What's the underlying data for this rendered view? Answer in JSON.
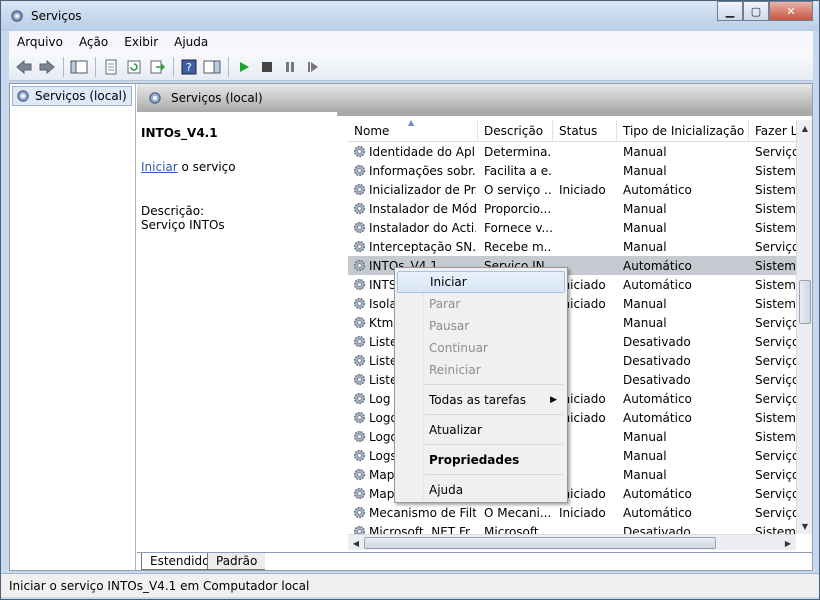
{
  "window": {
    "title": "Serviços",
    "minimize": "▁",
    "maximize": "▢",
    "close": "✕"
  },
  "menubar": [
    {
      "label": "Arquivo"
    },
    {
      "label": "Ação"
    },
    {
      "label": "Exibir"
    },
    {
      "label": "Ajuda"
    }
  ],
  "tree": {
    "item_label": "Serviços (local)"
  },
  "header": {
    "title": "Serviços (local)"
  },
  "details": {
    "service_name": "INTOs_V4.1",
    "action_link": "Iniciar",
    "action_suffix": " o serviço",
    "description_label": "Descrição:",
    "description_text": "Serviço INTOs"
  },
  "columns": {
    "name": "Nome",
    "description": "Descrição",
    "status": "Status",
    "startup": "Tipo de Inicialização",
    "logon": "Fazer Lo"
  },
  "rows": [
    {
      "name": "Identidade do Apli...",
      "description": "Determina...",
      "status": "",
      "startup": "Manual",
      "logon": "Serviço"
    },
    {
      "name": "Informações sobr...",
      "description": "Facilita a e...",
      "status": "",
      "startup": "Manual",
      "logon": "Sistema"
    },
    {
      "name": "Inicializador de Pr...",
      "description": "O serviço ...",
      "status": "Iniciado",
      "startup": "Automático",
      "logon": "Sistema"
    },
    {
      "name": "Instalador de Mód...",
      "description": "Proporcio...",
      "status": "",
      "startup": "Manual",
      "logon": "Sistema"
    },
    {
      "name": "Instalador do Acti...",
      "description": "Fornece v...",
      "status": "",
      "startup": "Manual",
      "logon": "Sistema"
    },
    {
      "name": "Interceptação SN...",
      "description": "Recebe m...",
      "status": "",
      "startup": "Manual",
      "logon": "Serviço"
    },
    {
      "name": "INTOs_V4.1",
      "description": "Serviço IN...",
      "status": "",
      "startup": "Automático",
      "logon": "Sistema"
    },
    {
      "name": "INTS",
      "description": "",
      "status": "Iniciado",
      "startup": "Automático",
      "logon": "Sistema"
    },
    {
      "name": "Isola",
      "description": "",
      "status": "Iniciado",
      "startup": "Manual",
      "logon": "Sistema"
    },
    {
      "name": "Ktml",
      "description": "",
      "status": "",
      "startup": "Manual",
      "logon": "Serviço"
    },
    {
      "name": "Liste",
      "description": "",
      "status": "",
      "startup": "Desativado",
      "logon": "Serviço"
    },
    {
      "name": "Liste",
      "description": "",
      "status": "",
      "startup": "Desativado",
      "logon": "Serviço"
    },
    {
      "name": "Liste",
      "description": "",
      "status": "",
      "startup": "Desativado",
      "logon": "Serviço"
    },
    {
      "name": "Log",
      "description": "",
      "status": "Iniciado",
      "startup": "Automático",
      "logon": "Serviço"
    },
    {
      "name": "Logo",
      "description": "",
      "status": "Iniciado",
      "startup": "Automático",
      "logon": "Sistema"
    },
    {
      "name": "Logo",
      "description": "",
      "status": "",
      "startup": "Manual",
      "logon": "Sistema"
    },
    {
      "name": "Logs",
      "description": "",
      "status": "",
      "startup": "Manual",
      "logon": "Serviço"
    },
    {
      "name": "Map",
      "description": "",
      "status": "",
      "startup": "Manual",
      "logon": "Serviço"
    },
    {
      "name": "Map",
      "description": "",
      "status": "Iniciado",
      "startup": "Automático",
      "logon": "Serviço"
    },
    {
      "name": "Mecanismo de Filt...",
      "description": "O Mecani...",
      "status": "Iniciado",
      "startup": "Automático",
      "logon": "Serviço"
    },
    {
      "name": "Microsoft .NET Fr...",
      "description": "Microsoft ...",
      "status": "",
      "startup": "Desativado",
      "logon": "Sistema"
    }
  ],
  "tabs": [
    {
      "label": "Estendido"
    },
    {
      "label": "Padrão"
    }
  ],
  "statusbar": {
    "text": "Iniciar o serviço INTOs_V4.1 em Computador local"
  },
  "context_menu": {
    "items": [
      {
        "label": "Iniciar",
        "state": "highlighted"
      },
      {
        "label": "Parar",
        "state": "disabled"
      },
      {
        "label": "Pausar",
        "state": "disabled"
      },
      {
        "label": "Continuar",
        "state": "disabled"
      },
      {
        "label": "Reiniciar",
        "state": "disabled"
      },
      {
        "label": "Todas as tarefas",
        "state": "submenu"
      },
      {
        "label": "Atualizar",
        "state": "enabled"
      },
      {
        "label": "Propriedades",
        "state": "default"
      },
      {
        "label": "Ajuda",
        "state": "enabled"
      }
    ]
  },
  "colors": {
    "selection": "#c5c9d0",
    "link": "#2a5db0",
    "disabled_text": "#8d8d8d"
  },
  "icons": {
    "gear": "service-gear-icon",
    "back": "back-arrow-icon",
    "forward": "forward-arrow-icon",
    "play": "start-icon",
    "stop": "stop-icon",
    "pause": "pause-icon",
    "restart": "restart-icon"
  }
}
